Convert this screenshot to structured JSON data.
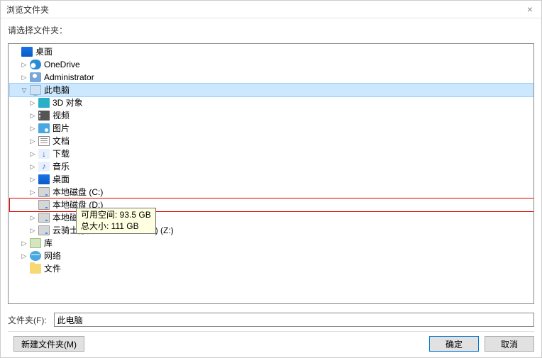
{
  "title": "浏览文件夹",
  "prompt": "请选择文件夹：",
  "close_glyph": "×",
  "tree": {
    "desktop": "桌面",
    "onedrive": "OneDrive",
    "administrator": "Administrator",
    "thispc": "此电脑",
    "objects3d": "3D 对象",
    "videos": "视频",
    "pictures": "图片",
    "documents": "文档",
    "downloads": "下载",
    "music": "音乐",
    "desk2": "桌面",
    "drive_c": "本地磁盘 (C:)",
    "drive_d": "本地磁盘 (D:)",
    "drive_e_prefix": "本地磁盘 (",
    "clouddrive_prefix": "云骑士存储",
    "clouddrive_suffix": "9) (Z:)",
    "libraries": "库",
    "network": "网络",
    "files": "文件"
  },
  "tooltip": {
    "line1": "可用空间: 93.5 GB",
    "line2": "总大小: 111 GB"
  },
  "footer": {
    "folder_label": "文件夹(F):",
    "folder_value": "此电脑",
    "new_folder": "新建文件夹(M)",
    "ok": "确定",
    "cancel": "取消"
  },
  "glyph": {
    "right": "▷",
    "down": "▽"
  }
}
